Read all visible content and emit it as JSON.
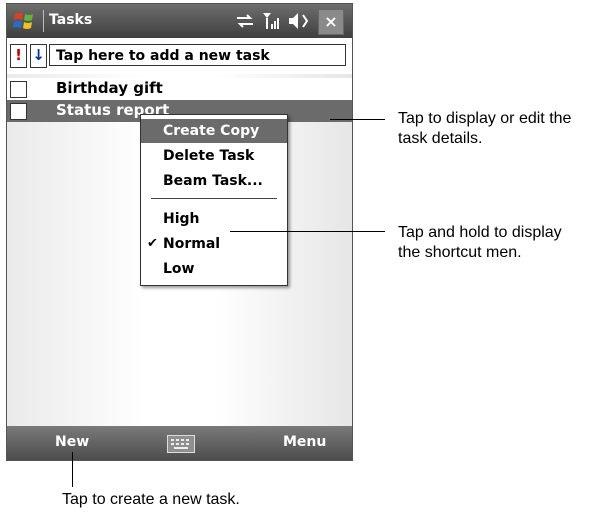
{
  "window": {
    "title": "Tasks",
    "close_label": "×"
  },
  "status_icons": [
    "sync-icon",
    "signal-icon",
    "volume-icon"
  ],
  "new_task_bar": {
    "priority_glyph": "!",
    "sort_glyph": "↓",
    "placeholder": "Tap here to add a new task"
  },
  "tasks": [
    {
      "label": "Birthday gift",
      "checked": false,
      "selected": false
    },
    {
      "label": "Status report",
      "checked": false,
      "selected": true
    }
  ],
  "context_menu": {
    "items": [
      {
        "label": "Create Copy",
        "selected": true
      },
      {
        "label": "Delete Task"
      },
      {
        "label": "Beam Task..."
      }
    ],
    "priority_items": [
      {
        "label": "High",
        "checked": false
      },
      {
        "label": "Normal",
        "checked": true
      },
      {
        "label": "Low",
        "checked": false
      }
    ],
    "check_glyph": "✔"
  },
  "bottom_bar": {
    "left_label": "New",
    "right_label": "Menu"
  },
  "callouts": [
    {
      "line1": "Tap to display or edit the",
      "line2": "task details."
    },
    {
      "line1": "Tap and hold to display",
      "line2": "the shortcut men."
    },
    {
      "line1": "Tap to create a new task."
    }
  ],
  "colors": {
    "title_bar": "#4a4a4a",
    "selection": "#6b6b6b",
    "priority": "#cc0000",
    "sort": "#0033aa"
  }
}
